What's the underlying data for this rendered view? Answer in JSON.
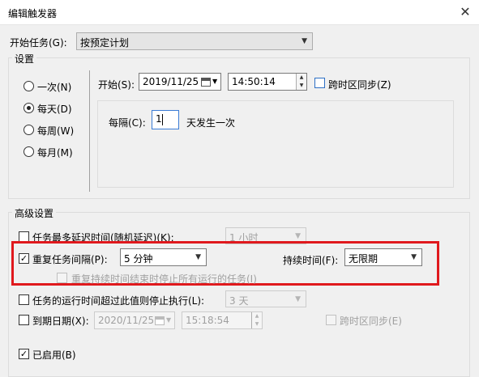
{
  "window": {
    "title": "编辑触发器",
    "close_glyph": "✕"
  },
  "begin_task": {
    "label": "开始任务(G):",
    "value": "按预定计划"
  },
  "settings": {
    "group_label": "设置",
    "schedule_options": [
      {
        "label": "一次(N)",
        "selected": false
      },
      {
        "label": "每天(D)",
        "selected": true
      },
      {
        "label": "每周(W)",
        "selected": false
      },
      {
        "label": "每月(M)",
        "selected": false
      }
    ],
    "start_label": "开始(S):",
    "start_date": "2019/11/25",
    "start_time": "14:50:14",
    "sync_timezones_label": "跨时区同步(Z)",
    "sync_timezones_checked": false,
    "recur_label": "每隔(C):",
    "recur_value": "1",
    "recur_suffix": "天发生一次"
  },
  "advanced": {
    "group_label": "高级设置",
    "delay": {
      "label": "任务最多延迟时间(随机延迟)(K):",
      "checked": false,
      "value": "1 小时"
    },
    "repeat": {
      "label": "重复任务间隔(P):",
      "checked": true,
      "value": "5 分钟",
      "duration_label": "持续时间(F):",
      "duration_value": "无限期",
      "stop_all_label": "重复持续时间结束时停止所有运行的任务(I)",
      "stop_all_checked": false
    },
    "stop_longer": {
      "label": "任务的运行时间超过此值则停止执行(L):",
      "checked": false,
      "value": "3 天"
    },
    "expire": {
      "label": "到期日期(X):",
      "checked": false,
      "date": "2020/11/25",
      "time": "15:18:54",
      "sync_label": "跨时区同步(E)",
      "sync_checked": false
    },
    "enabled": {
      "label": "已启用(B)",
      "checked": true
    }
  },
  "check_glyph": "✓",
  "highlight_color": "#e0191d"
}
